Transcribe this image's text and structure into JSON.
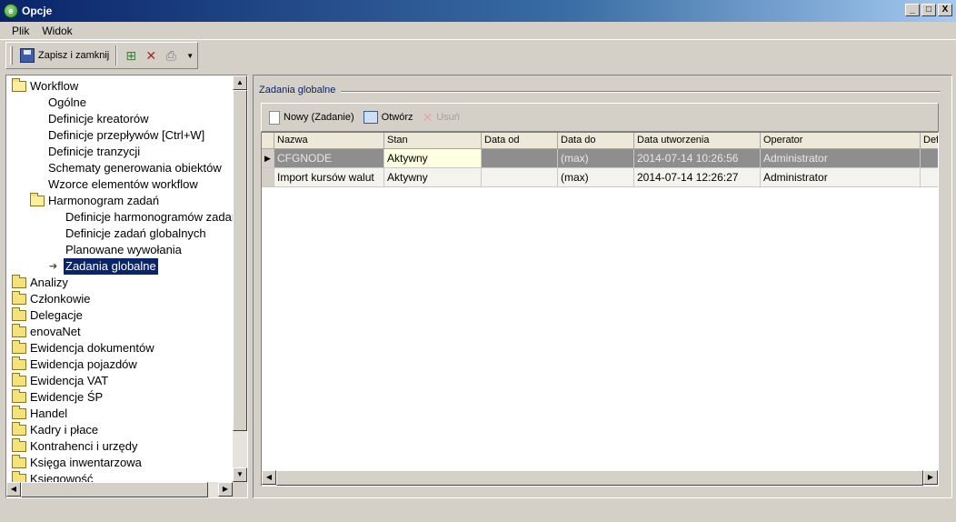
{
  "window": {
    "title": "Opcje",
    "icon": "app-icon",
    "minimize": "_",
    "maximize": "□",
    "close": "X"
  },
  "menu": {
    "items": [
      {
        "label": "Plik"
      },
      {
        "label": "Widok"
      }
    ]
  },
  "toolbar": {
    "save_label": "Zapisz i zamknij"
  },
  "tree": {
    "items": [
      {
        "label": "Workflow"
      },
      {
        "label": "Ogólne"
      },
      {
        "label": "Definicje kreatorów"
      },
      {
        "label": "Definicje przepływów [Ctrl+W]"
      },
      {
        "label": "Definicje tranzycji"
      },
      {
        "label": "Schematy generowania obiektów"
      },
      {
        "label": "Wzorce elementów workflow"
      },
      {
        "label": "Harmonogram zadań"
      },
      {
        "label": "Definicje harmonogramów zadań"
      },
      {
        "label": "Definicje zadań globalnych"
      },
      {
        "label": "Planowane wywołania"
      },
      {
        "label": "Zadania globalne"
      },
      {
        "label": "Analizy"
      },
      {
        "label": "Członkowie"
      },
      {
        "label": "Delegacje"
      },
      {
        "label": "enovaNet"
      },
      {
        "label": "Ewidencja dokumentów"
      },
      {
        "label": "Ewidencja pojazdów"
      },
      {
        "label": "Ewidencja VAT"
      },
      {
        "label": "Ewidencje ŚP"
      },
      {
        "label": "Handel"
      },
      {
        "label": "Kadry i płace"
      },
      {
        "label": "Kontrahenci i urzędy"
      },
      {
        "label": "Księga inwentarzowa"
      },
      {
        "label": "Księgowość"
      }
    ]
  },
  "panel": {
    "title": "Zadania globalne",
    "toolbar": {
      "new_label": "Nowy (Zadanie)",
      "open_label": "Otwórz",
      "delete_label": "Usuń"
    },
    "grid": {
      "columns": [
        "Nazwa",
        "Stan",
        "Data od",
        "Data do",
        "Data utworzenia",
        "Operator",
        "Def"
      ],
      "rows": [
        {
          "cells": [
            "CFGNODE",
            "Aktywny",
            "",
            "(max)",
            "2014-07-14 10:26:56",
            "Administrator",
            ""
          ],
          "selected": true
        },
        {
          "cells": [
            "Import kursów walut",
            "Aktywny",
            "",
            "(max)",
            "2014-07-14 12:26:27",
            "Administrator",
            ""
          ],
          "selected": false
        }
      ]
    }
  }
}
